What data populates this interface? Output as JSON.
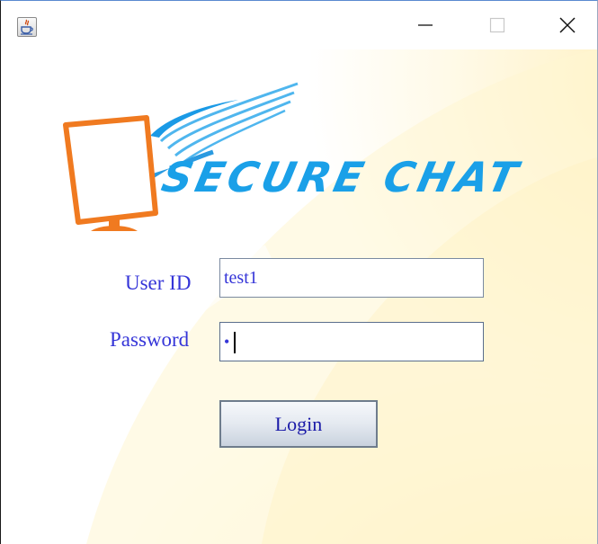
{
  "window": {
    "icon": "java-app-icon",
    "controls": {
      "minimize": "minimize-icon",
      "maximize": "maximize-icon",
      "close": "close-icon"
    }
  },
  "logo": {
    "text": "SECURE CHAT",
    "icon": "monitor-icon",
    "colors": {
      "monitor": "#f07a20",
      "text": "#1aa0e8"
    }
  },
  "form": {
    "user_id_label": "User ID",
    "user_id_value": "test1",
    "password_label": "Password",
    "password_mask": "•"
  },
  "login_label": "Login",
  "colors": {
    "label": "#3535d8",
    "background_tint": "#fff3c8"
  }
}
